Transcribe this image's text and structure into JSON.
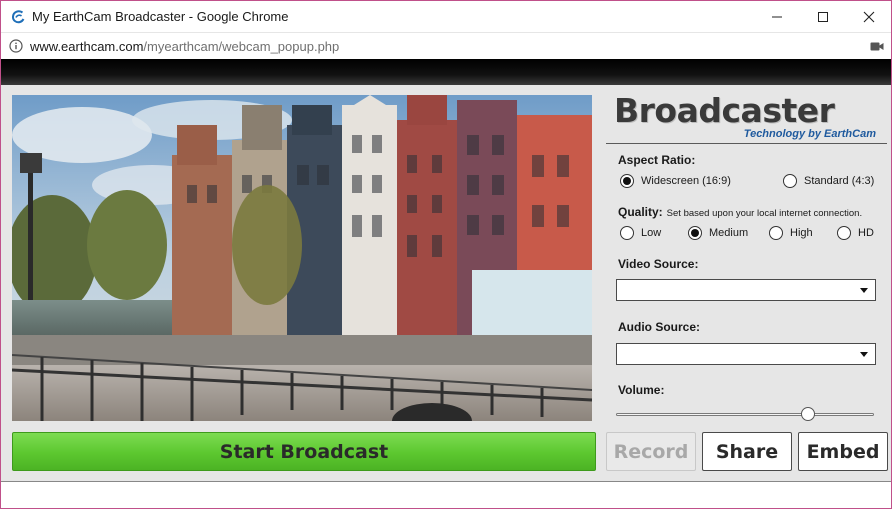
{
  "window": {
    "title": "My EarthCam Broadcaster - Google Chrome",
    "url_host": "www.earthcam.com",
    "url_path": "/myearthcam/webcam_popup.php"
  },
  "brand": {
    "name": "Broadcaster",
    "tagline": "Technology by EarthCam",
    "accent_color": "#1f5a9e"
  },
  "settings": {
    "aspect_ratio": {
      "label": "Aspect Ratio:",
      "options": [
        "Widescreen (16:9)",
        "Standard (4:3)"
      ],
      "selected": "Widescreen (16:9)"
    },
    "quality": {
      "label": "Quality:",
      "note": "Set based upon your local internet connection.",
      "options": [
        "Low",
        "Medium",
        "High",
        "HD"
      ],
      "selected": "Medium"
    },
    "video_source": {
      "label": "Video Source:",
      "value": ""
    },
    "audio_source": {
      "label": "Audio Source:",
      "value": ""
    },
    "volume": {
      "label": "Volume:",
      "level": 0.76
    }
  },
  "actions": {
    "start": "Start Broadcast",
    "record": "Record",
    "share": "Share",
    "embed": "Embed",
    "start_color": "#5cc72f"
  },
  "icons": {
    "title": "earthcam-logo-icon",
    "info": "info-icon",
    "camera": "camera-icon",
    "minimize": "minimize-icon",
    "maximize": "maximize-icon",
    "close": "close-icon"
  }
}
